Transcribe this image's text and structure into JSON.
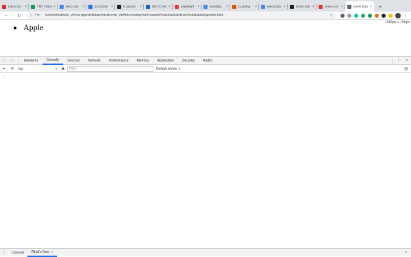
{
  "browser": {
    "tabs": [
      {
        "label": "Inbox (8) -",
        "color": "#d93025"
      },
      {
        "label": "TMT Tasks",
        "color": "#0f9d58"
      },
      {
        "label": "Me | Lear",
        "color": "#4285f4"
      },
      {
        "label": "123-Esse",
        "color": "#1a73e8"
      },
      {
        "label": "9 JavaSc",
        "color": "#202124"
      },
      {
        "label": "IRCTC Ne",
        "color": "#1565c0"
      },
      {
        "label": "MakeMyT",
        "color": "#e53935"
      },
      {
        "label": "sum(5)(1",
        "color": "#4285f4"
      },
      {
        "label": "Currying",
        "color": "#e65100"
      },
      {
        "label": "event bub",
        "color": "#4285f4"
      },
      {
        "label": "Event Bub",
        "color": "#202124"
      },
      {
        "label": "How to Ac",
        "color": "#e53935"
      },
      {
        "label": "Event Bub",
        "color": "#5f6368",
        "active": true
      }
    ],
    "new_tab": "+",
    "toolbar": {
      "back": "←",
      "forward": "→",
      "reload": "↻",
      "file_label": "File",
      "url": "/Users/shubham_verma-ggn/Desktop/SHUBHAM_VERMA/Nodejs%20Youtube%20channae/Event%20bubbling/index.html",
      "star": "☆",
      "menu": "⋮",
      "extension_colors": [
        "#5f6368",
        "#9aa0a6",
        "#15c39a",
        "#34a853",
        "#0f9d58",
        "#e8710a",
        "#202124",
        "#fbbc04"
      ]
    }
  },
  "page": {
    "dimensions": "1680px × 150px",
    "list_items": [
      "Apple"
    ]
  },
  "devtools": {
    "tabs": [
      "Elements",
      "Console",
      "Sources",
      "Network",
      "Performance",
      "Memory",
      "Application",
      "Security",
      "Audits"
    ],
    "active_tab": "Console",
    "context": "top",
    "filter_placeholder": "Filter",
    "levels": "Default levels",
    "prompt": "›",
    "drawer": {
      "tabs": [
        "Console",
        "What's New"
      ],
      "active": "What's New"
    }
  }
}
